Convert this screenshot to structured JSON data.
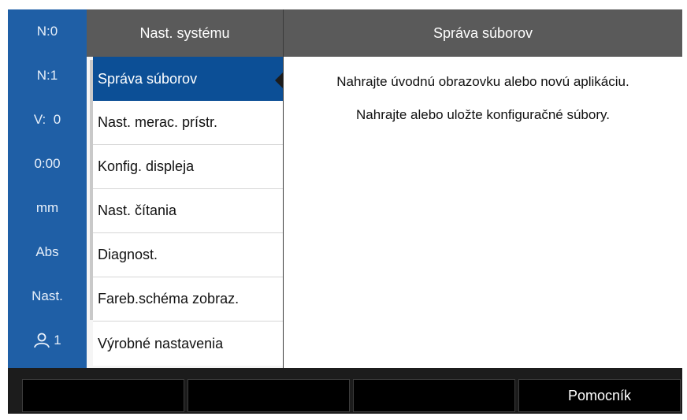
{
  "status_bar": {
    "items": [
      {
        "label": "N:0"
      },
      {
        "label": "N:1"
      },
      {
        "label": "V:  0"
      },
      {
        "label": "0:00"
      },
      {
        "label": "mm"
      },
      {
        "label": "Abs"
      },
      {
        "label": "Nast."
      },
      {
        "label": "1",
        "icon": "user-icon"
      }
    ]
  },
  "menu": {
    "title": "Nast. systému",
    "items": [
      {
        "label": "Správa súborov",
        "selected": true
      },
      {
        "label": "Nast. merac. prístr."
      },
      {
        "label": "Konfig. displeja"
      },
      {
        "label": "Nast. čítania"
      },
      {
        "label": "Diagnost."
      },
      {
        "label": "Fareb.schéma zobraz."
      },
      {
        "label": "Výrobné nastavenia"
      }
    ]
  },
  "content": {
    "title": "Správa súborov",
    "lines": [
      "Nahrajte úvodnú obrazovku alebo novú aplikáciu.",
      "Nahrajte alebo uložte konfiguračné súbory."
    ]
  },
  "softkeys": [
    {
      "label": ""
    },
    {
      "label": ""
    },
    {
      "label": ""
    },
    {
      "label": "Pomocník"
    }
  ],
  "colors": {
    "status_bar": "#1f5fa6",
    "header": "#5a5a5a",
    "selected": "#0c4f96",
    "softkey": "#000000"
  }
}
